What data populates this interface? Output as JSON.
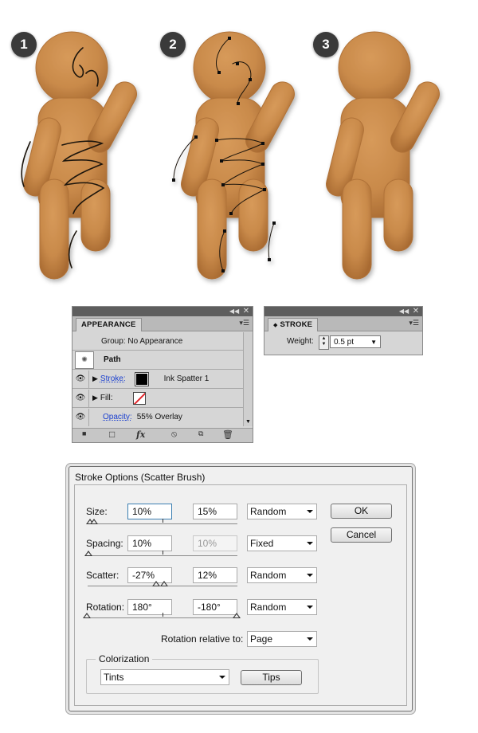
{
  "steps": [
    "1",
    "2",
    "3"
  ],
  "appearance_panel": {
    "tab_title": "APPEARANCE",
    "collapse_icon": "double-left-arrow",
    "close_icon": "close-x",
    "menu_icon": "panel-menu",
    "group_label": "Group: No Appearance",
    "path_label": "Path",
    "stroke": {
      "label": "Stroke:",
      "brush": "Ink Spatter 1",
      "color": "#000000"
    },
    "fill": {
      "label": "Fill:",
      "color": "none"
    },
    "opacity": {
      "label": "Opacity:",
      "value": "55% Overlay"
    },
    "bottom_icons": [
      "new-art-basic-icon",
      "clear-icon",
      "fx-icon",
      "reduce-icon",
      "duplicate-icon",
      "delete-icon"
    ],
    "fx_label": "fx"
  },
  "stroke_panel": {
    "tab_title": "STROKE",
    "weight_label": "Weight:",
    "weight_value": "0.5 pt"
  },
  "dialog": {
    "title": "Stroke Options (Scatter Brush)",
    "size": {
      "label": "Size:",
      "min": "10%",
      "max": "15%",
      "mode": "Random"
    },
    "spacing": {
      "label": "Spacing:",
      "min": "10%",
      "max": "10%",
      "mode": "Fixed"
    },
    "scatter": {
      "label": "Scatter:",
      "min": "-27%",
      "max": "12%",
      "mode": "Random"
    },
    "rotation": {
      "label": "Rotation:",
      "min": "180°",
      "max": "-180°",
      "mode": "Random"
    },
    "rotation_relative": {
      "label": "Rotation relative to:",
      "value": "Page"
    },
    "colorization": {
      "group_label": "Colorization",
      "method": "Tints"
    },
    "buttons": {
      "ok": "OK",
      "cancel": "Cancel",
      "tips": "Tips"
    }
  }
}
